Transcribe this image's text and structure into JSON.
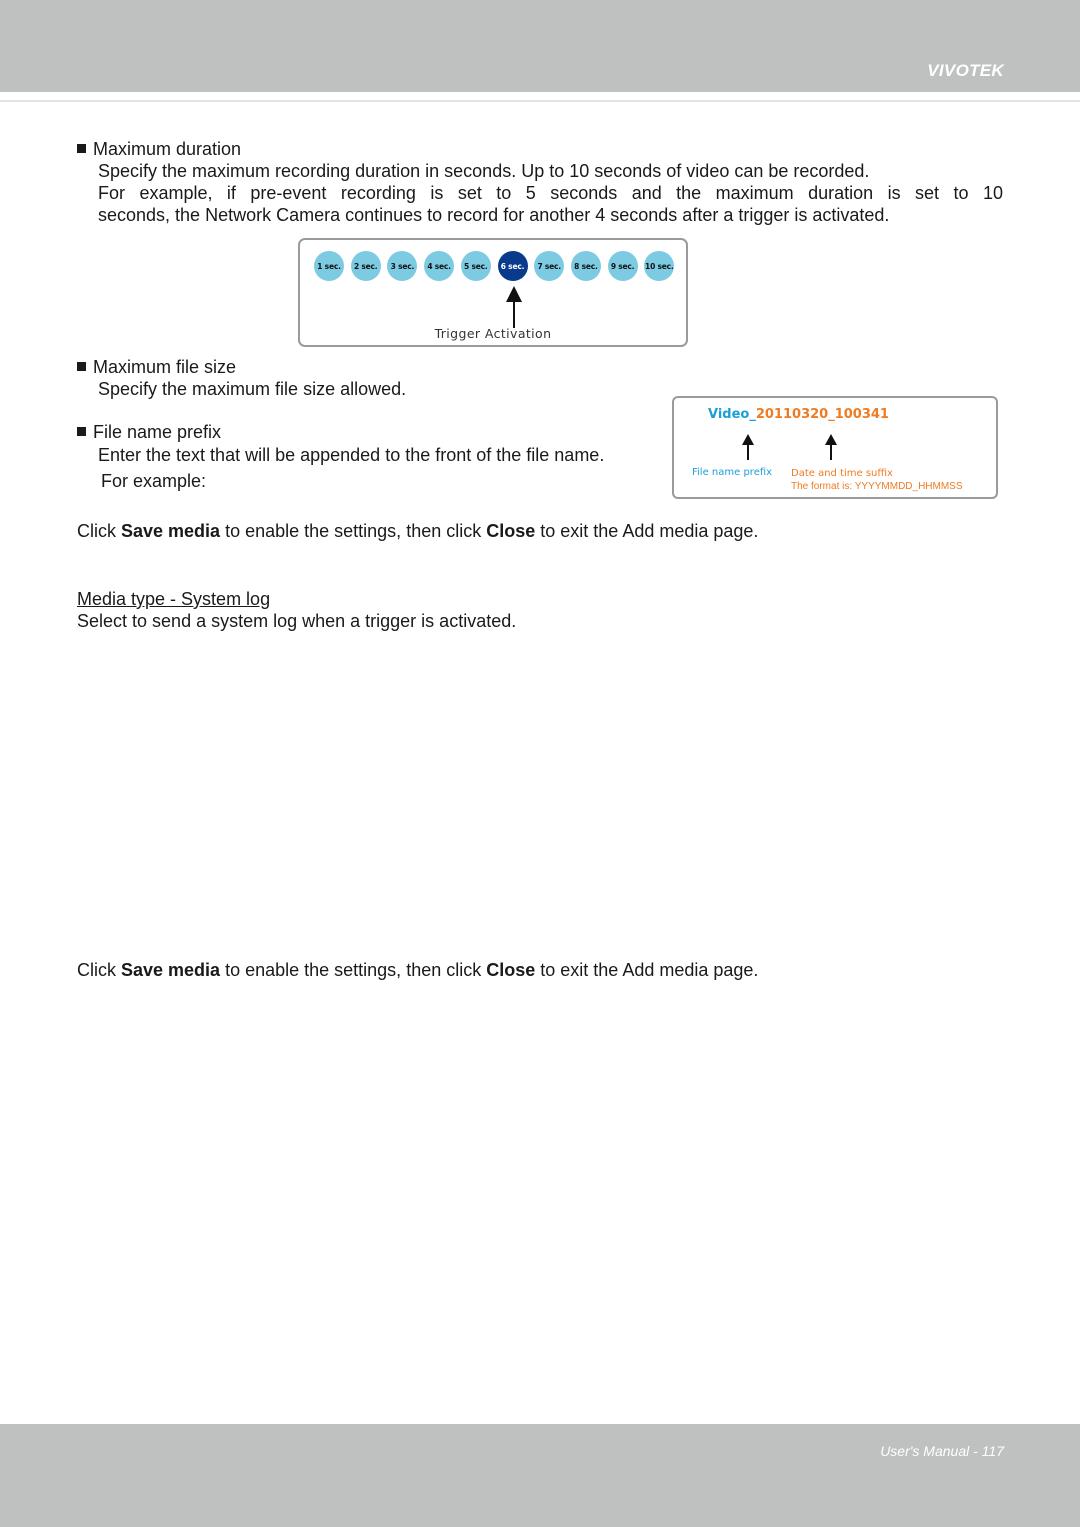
{
  "header": {
    "brand": "VIVOTEK"
  },
  "sections": {
    "max_duration": {
      "title": "Maximum duration",
      "line1": "Specify the maximum recording duration in seconds. Up to 10 seconds of video can be recorded.",
      "line2": "For example, if pre-event recording is set to 5 seconds and the maximum duration is set to 10",
      "line3": "seconds, the Network Camera continues to record for another 4 seconds after a trigger is activated."
    },
    "max_file_size": {
      "title": "Maximum file size",
      "desc": "Specify the maximum file size allowed."
    },
    "file_name_prefix": {
      "title": "File name prefix",
      "desc": "Enter the text that will be appended to the front of the file name.",
      "example": "For example:"
    },
    "save_note_1": {
      "pre": "Click ",
      "bold1": "Save media",
      "mid": " to enable the settings, then click ",
      "bold2": "Close",
      "post": " to exit the Add media page."
    },
    "system_log": {
      "title": "Media type - System log",
      "desc": "Select to send a system log when a trigger is activated."
    },
    "save_note_2": {
      "pre": "Click ",
      "bold1": "Save media",
      "mid": " to enable the settings, then click ",
      "bold2": "Close",
      "post": " to exit the Add media page."
    }
  },
  "timeline_figure": {
    "seconds": [
      "1 sec.",
      "2 sec.",
      "3 sec.",
      "4 sec.",
      "5 sec.",
      "6 sec.",
      "7 sec.",
      "8 sec.",
      "9 sec.",
      "10 sec."
    ],
    "active_index": 5,
    "trigger_label": "Trigger Activation",
    "colors": {
      "inactive": "#7ccbe3",
      "active": "#0a3a8c"
    }
  },
  "filename_figure": {
    "prefix": "Video_",
    "suffix": "20110320_100341",
    "prefix_label": "File name prefix",
    "suffix_label": "Date and time suffix",
    "format_label": "The format is: YYYYMMDD_HHMMSS",
    "colors": {
      "prefix": "#1b9fd8",
      "suffix": "#ef7b22"
    }
  },
  "footer": {
    "page_label": "User's Manual - 117"
  }
}
